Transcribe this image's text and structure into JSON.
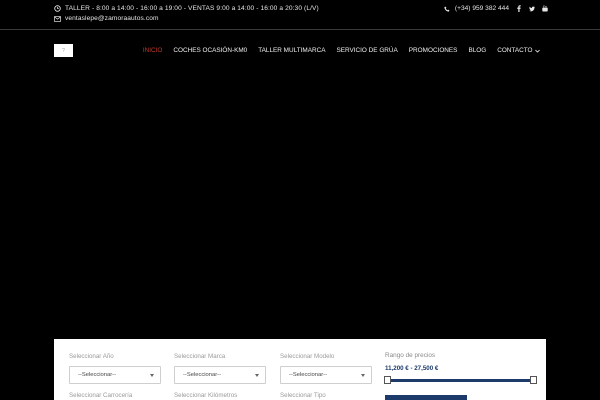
{
  "topbar": {
    "hours": "TALLER - 8:00 a 14:00 - 16:00 a 19:00 - VENTAS 9:00 a 14:00 - 16:00 a 20:30 (L/V)",
    "email": "ventaslepe@zamoraautos.com",
    "phone": "(+34) 959 382 444",
    "socials": [
      "facebook-icon",
      "twitter-icon",
      "youtube-icon"
    ]
  },
  "nav": {
    "items": [
      {
        "label": "INICIO",
        "active": true
      },
      {
        "label": "COCHES OCASIÓN-KM0"
      },
      {
        "label": "TALLER MULTIMARCA"
      },
      {
        "label": "SERVICIO DE GRÚA"
      },
      {
        "label": "PROMOCIONES"
      },
      {
        "label": "BLOG"
      },
      {
        "label": "CONTACTO",
        "dropdown": true
      }
    ],
    "active_color": "#c0392b"
  },
  "search": {
    "year_label": "Seleccionar Año",
    "make_label": "Seleccionar Marca",
    "model_label": "Seleccionar Modelo",
    "body_label": "Seleccionar Carrocería",
    "km_label": "Seleccionar Kilómetros",
    "type_label": "Seleccionar Tipo",
    "select_value": "--Seleccionar--",
    "price_label": "Rango de precios",
    "price_range": "11,200 € - 27,500 €",
    "accent_color": "#1c3b6b"
  }
}
